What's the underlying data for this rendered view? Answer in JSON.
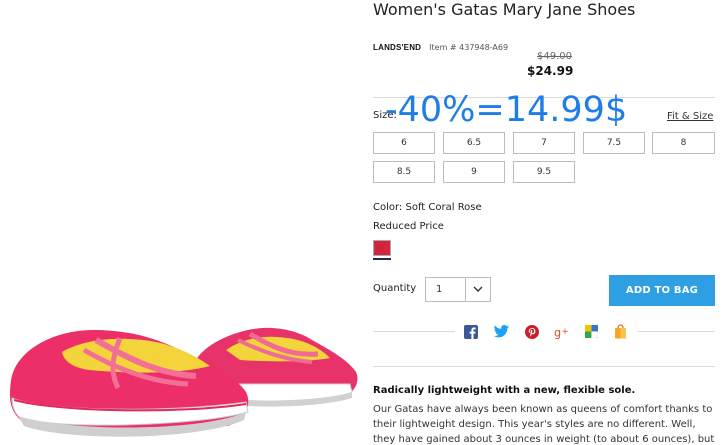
{
  "product": {
    "title": "Women's Gatas Mary Jane Shoes",
    "brand": "LANDS'END",
    "item_number": "Item # 437948-A69",
    "original_price": "$49.00",
    "sale_price": "$24.99"
  },
  "annotation": "-40%=14.99$",
  "size": {
    "label": "Size:",
    "fit_link": "Fit & Size",
    "options": [
      "6",
      "6.5",
      "7",
      "7.5",
      "8",
      "8.5",
      "9",
      "9.5"
    ]
  },
  "color": {
    "label": "Color: Soft Coral Rose",
    "reduced": "Reduced Price",
    "swatch_hex": "#d0243f"
  },
  "quantity": {
    "label": "Quantity",
    "value": "1"
  },
  "cart": {
    "add_label": "ADD TO BAG"
  },
  "share_icons": [
    "facebook-icon",
    "twitter-icon",
    "pinterest-icon",
    "google-plus-icon",
    "delicious-icon",
    "shopping-bag-icon"
  ],
  "description": {
    "heading": "Radically lightweight with a new, flexible sole.",
    "lines": [
      "Our Gatas have always been known as queens of comfort thanks to",
      "their lightweight design. This year's styles are no different. Well,",
      "they have gained about 3 ounces in weight (to about 6 ounces), but"
    ]
  }
}
